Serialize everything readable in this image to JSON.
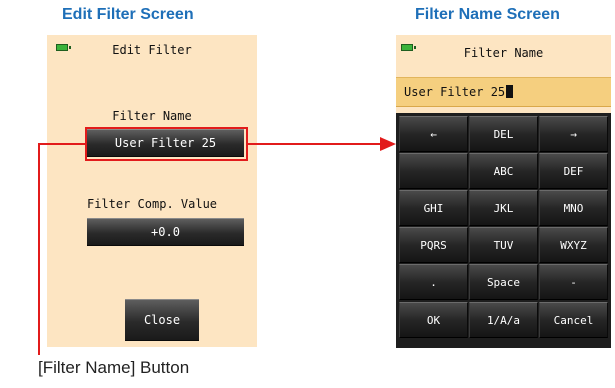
{
  "headings": {
    "left": "Edit Filter Screen",
    "right": "Filter Name Screen"
  },
  "edit_screen": {
    "title": "Edit Filter",
    "filter_name_label": "Filter Name",
    "filter_name_value": "User Filter 25",
    "comp_label": "Filter Comp. Value",
    "comp_value": "+0.0",
    "close_label": "Close"
  },
  "name_screen": {
    "title": "Filter Name",
    "input_value": "User Filter 25",
    "keys": [
      [
        "←",
        "DEL",
        "→"
      ],
      [
        "",
        "ABC",
        "DEF"
      ],
      [
        "GHI",
        "JKL",
        "MNO"
      ],
      [
        "PQRS",
        "TUV",
        "WXYZ"
      ],
      [
        ".",
        "Space",
        "-"
      ],
      [
        "OK",
        "1/A/a",
        "Cancel"
      ]
    ]
  },
  "callout": {
    "label": "[Filter Name] Button",
    "color": "#e21b1b"
  },
  "colors": {
    "heading": "#1e6fb8",
    "screen_bg": "#fde5c2",
    "input_bg": "#f5cf7f"
  }
}
